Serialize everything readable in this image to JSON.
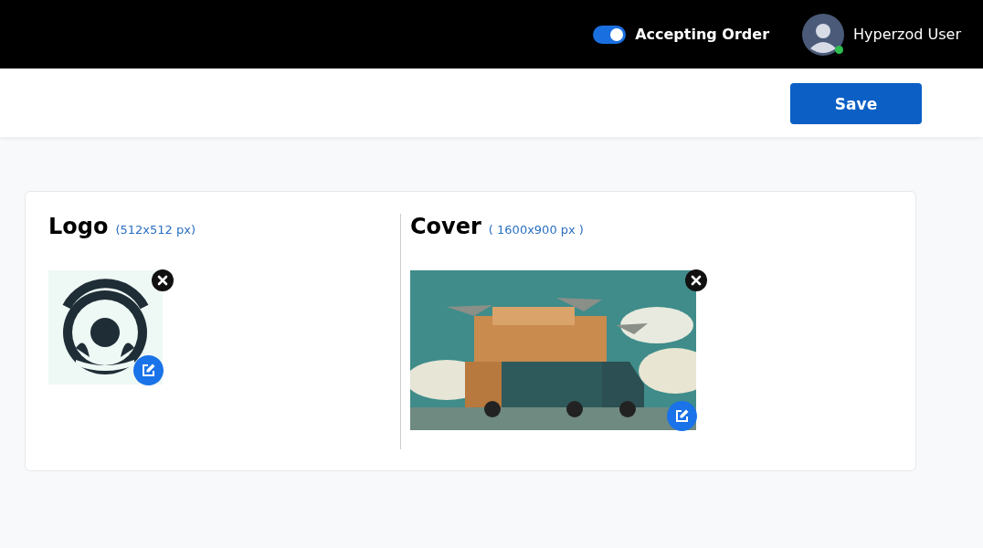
{
  "header": {
    "accepting_order": {
      "label": "Accepting Order",
      "on": true
    },
    "user": {
      "name": "Hyperzod User",
      "online": true
    }
  },
  "toolbar": {
    "save_button": "Save"
  },
  "media": [
    {
      "kind": "logo",
      "title": "Logo",
      "size_hint": "(512x512 px)"
    },
    {
      "kind": "cover",
      "title": "Cover",
      "size_hint": "( 1600x900 px )"
    }
  ]
}
